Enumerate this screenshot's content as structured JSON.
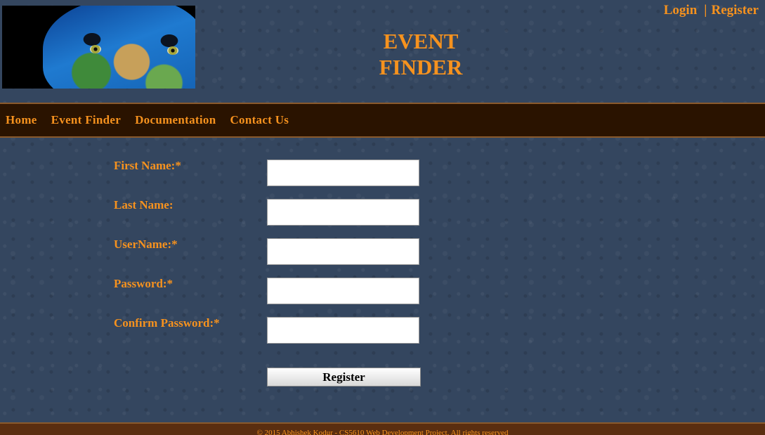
{
  "header": {
    "title_line1": "EVENT",
    "title_line2": "FINDER",
    "auth": {
      "login": "Login",
      "separator": "|",
      "register": "Register"
    }
  },
  "nav": {
    "items": [
      {
        "label": "Home"
      },
      {
        "label": "Event Finder"
      },
      {
        "label": "Documentation"
      },
      {
        "label": "Contact Us"
      }
    ]
  },
  "form": {
    "fields": [
      {
        "label": "First Name:*",
        "value": ""
      },
      {
        "label": "Last Name:",
        "value": ""
      },
      {
        "label": "UserName:*",
        "value": ""
      },
      {
        "label": "Password:*",
        "value": ""
      },
      {
        "label": "Confirm Password:*",
        "value": ""
      }
    ],
    "submit_label": "Register"
  },
  "footer": {
    "text": "© 2015 Abhishek Kodur - CS5610 Web Development Project. All rights reserved"
  },
  "colors": {
    "accent": "#f6921e",
    "background": "#34465f",
    "nav_background": "#2a1300",
    "footer_background": "#5a2e10"
  }
}
